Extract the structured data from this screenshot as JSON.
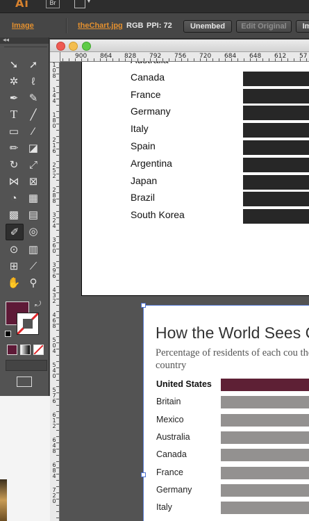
{
  "app": {
    "logo": "Ai",
    "bridge_label": "Br"
  },
  "control_bar": {
    "object_type": "Image",
    "file_link": "theChart.jpg",
    "color_mode": "RGB",
    "ppi": "PPI: 72",
    "buttons": [
      "Unembed",
      "Edit Original",
      "Im"
    ]
  },
  "ruler": {
    "top_ticks": [
      "900",
      "864",
      "828",
      "792",
      "756",
      "720",
      "684",
      "648",
      "612",
      "57"
    ],
    "left_ticks": [
      "108",
      "144",
      "180",
      "216",
      "252",
      "288",
      "324",
      "360",
      "396",
      "432",
      "468",
      "504",
      "540",
      "576",
      "612",
      "648",
      "684",
      "720"
    ]
  },
  "chart_top": {
    "type": "bar",
    "categories": [
      "Australia",
      "Canada",
      "France",
      "Germany",
      "Italy",
      "Spain",
      "Argentina",
      "Japan",
      "Brazil",
      "South Korea"
    ]
  },
  "chart_bottom": {
    "type": "bar",
    "title": "How the World Sees C",
    "subtitle": "Percentage of residents of each cou their country",
    "categories": [
      "United States",
      "Britain",
      "Mexico",
      "Australia",
      "Canada",
      "France",
      "Germany",
      "Italy"
    ],
    "highlight_color": "#5e2035",
    "bar_color": "#939190"
  },
  "swatches": {
    "fill": "#5e1a37",
    "stroke": "none"
  }
}
